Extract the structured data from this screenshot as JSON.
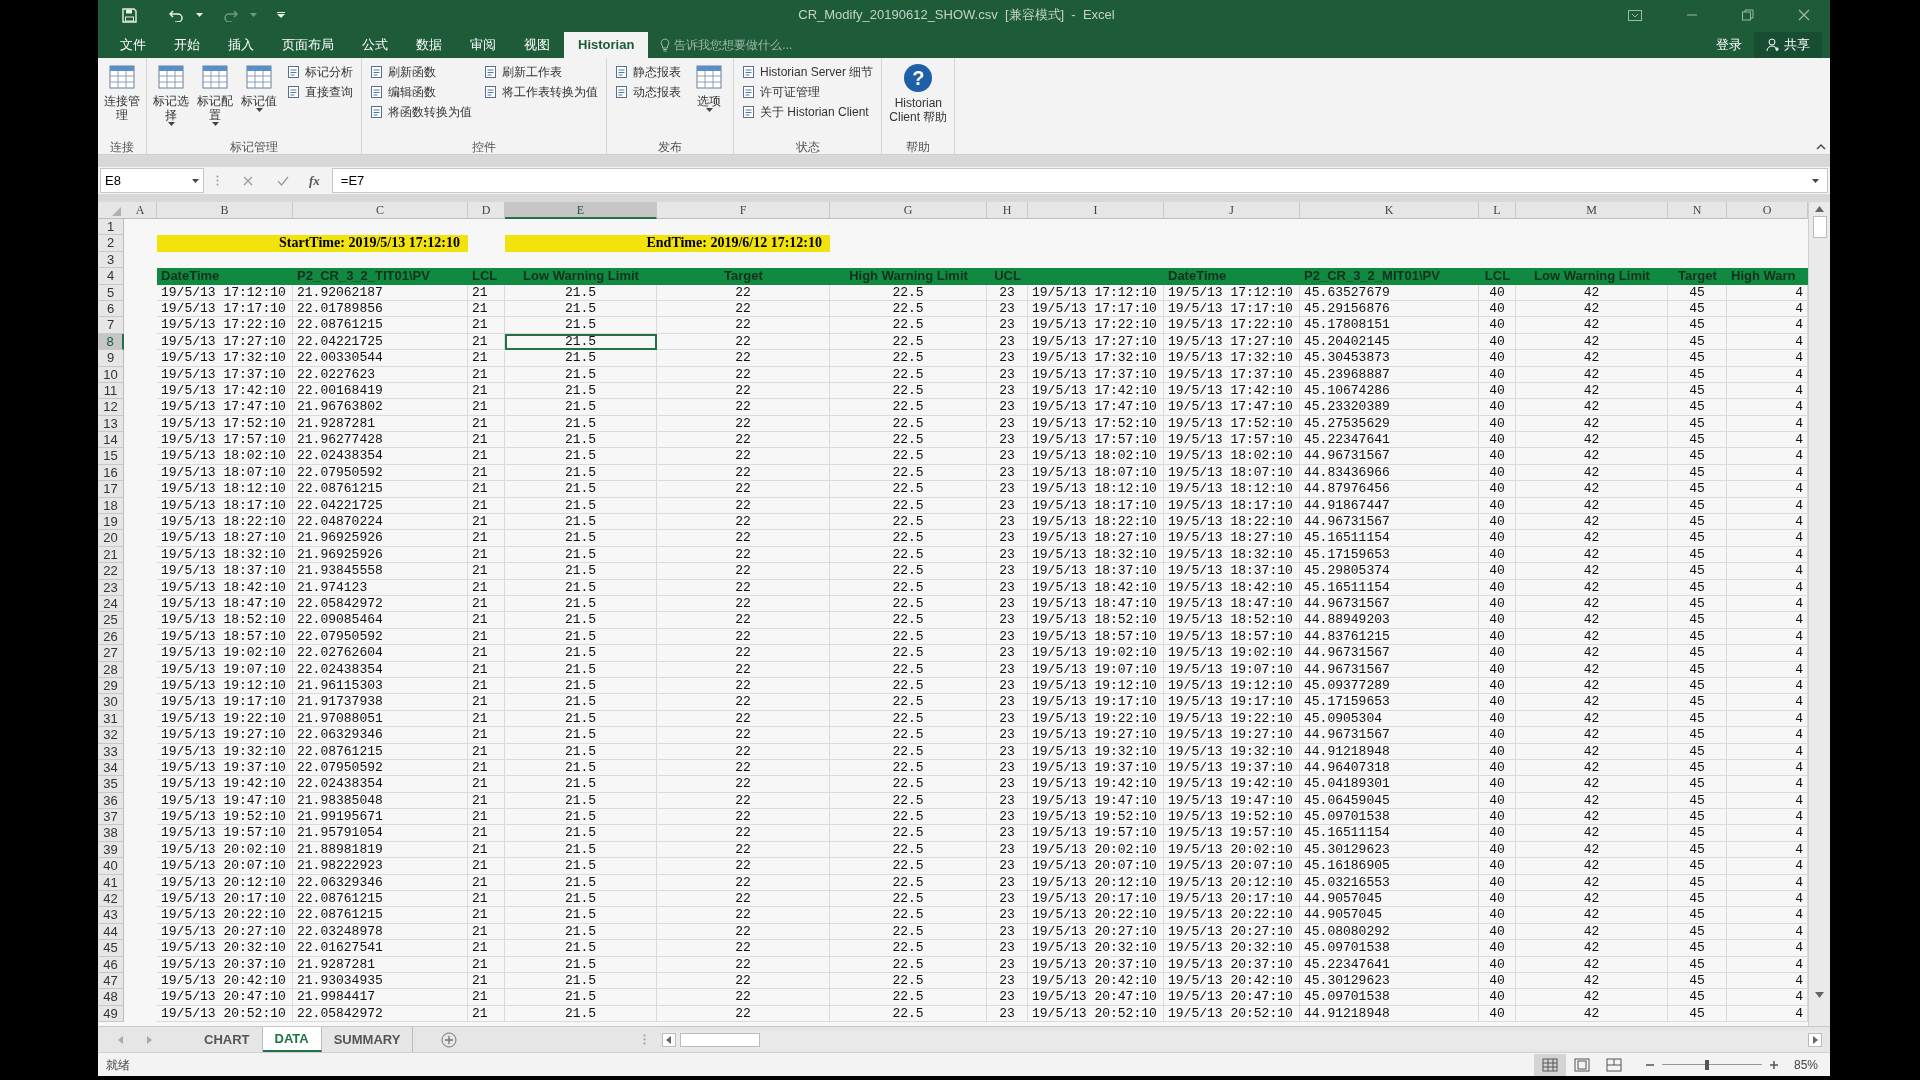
{
  "window": {
    "title": "CR_Modify_20190612_SHOW.csv  [兼容模式]  -  Excel"
  },
  "menu_tabs": [
    {
      "label": "文件",
      "selected": false
    },
    {
      "label": "开始",
      "selected": false
    },
    {
      "label": "插入",
      "selected": false
    },
    {
      "label": "页面布局",
      "selected": false
    },
    {
      "label": "公式",
      "selected": false
    },
    {
      "label": "数据",
      "selected": false
    },
    {
      "label": "审阅",
      "selected": false
    },
    {
      "label": "视图",
      "selected": false
    },
    {
      "label": "Historian",
      "selected": true
    }
  ],
  "tell_me": {
    "placeholder": "告诉我您想要做什么..."
  },
  "account": {
    "sign_in": "登录",
    "share": "共享"
  },
  "ribbon": {
    "groups": [
      {
        "label": "连接",
        "items": [
          {
            "kind": "large",
            "label": "连接管理",
            "dropdown": false
          }
        ]
      },
      {
        "label": "标记管理",
        "items": [
          {
            "kind": "large",
            "label": "标记选择",
            "dropdown": true
          },
          {
            "kind": "large",
            "label": "标记配置",
            "dropdown": true
          },
          {
            "kind": "large",
            "label": "标记值",
            "dropdown": true
          },
          {
            "kind": "stack",
            "labels": [
              "标记分析",
              "直接查询"
            ]
          }
        ]
      },
      {
        "label": "控件",
        "items": [
          {
            "kind": "stack",
            "labels": [
              "刷新函数",
              "编辑函数",
              "将函数转换为值"
            ]
          },
          {
            "kind": "stack",
            "labels": [
              "刷新工作表",
              "将工作表转换为值"
            ]
          }
        ]
      },
      {
        "label": "发布",
        "items": [
          {
            "kind": "stack",
            "labels": [
              "静态报表",
              "动态报表"
            ]
          },
          {
            "kind": "large",
            "label": "选项",
            "dropdown": true
          }
        ]
      },
      {
        "label": "状态",
        "items": [
          {
            "kind": "stack",
            "labels": [
              "Historian Server 细节",
              "许可证管理",
              "关于 Historian Client"
            ]
          }
        ]
      },
      {
        "label": "帮助",
        "items": [
          {
            "kind": "help",
            "symbol": "?",
            "label": "Historian Client 帮助"
          }
        ]
      }
    ]
  },
  "formula_bar": {
    "name_box": "E8",
    "function_label": "fx",
    "formula": "=E7"
  },
  "sheet": {
    "columns": [
      {
        "label": "A",
        "selected": false
      },
      {
        "label": "B",
        "selected": false
      },
      {
        "label": "C",
        "selected": false
      },
      {
        "label": "D",
        "selected": false
      },
      {
        "label": "E",
        "selected": true
      },
      {
        "label": "F",
        "selected": false
      },
      {
        "label": "G",
        "selected": false
      },
      {
        "label": "H",
        "selected": false
      },
      {
        "label": "I",
        "selected": false
      },
      {
        "label": "J",
        "selected": false
      },
      {
        "label": "K",
        "selected": false
      },
      {
        "label": "L",
        "selected": false
      },
      {
        "label": "M",
        "selected": false
      },
      {
        "label": "N",
        "selected": false
      },
      {
        "label": "O",
        "selected": false
      }
    ],
    "rows": [
      {
        "number": "1",
        "selected": false,
        "kind": "blank"
      },
      {
        "number": "2",
        "selected": false,
        "kind": "banner",
        "start": "StartTime: 2019/5/13 17:12:10",
        "end": "EndTime: 2019/6/12 17:12:10"
      },
      {
        "number": "3",
        "selected": false,
        "kind": "blank"
      },
      {
        "number": "4",
        "selected": false,
        "kind": "header",
        "left_headings": [
          "DateTime",
          "P2_CR_3_2_TIT01\\PV",
          "LCL",
          "Low Warning Limit",
          "Target",
          "High Warning Limit",
          "UCL"
        ],
        "right_headings": [
          "DateTime",
          "P2_CR_3_2_MIT01\\PV",
          "LCL",
          "Low Warning Limit",
          "Target",
          "High Warn"
        ]
      },
      {
        "number": "5",
        "selected": false,
        "kind": "data",
        "cells": [
          "19/5/13 17:12:10",
          "21.92062187",
          "21",
          "21.5",
          "22",
          "22.5",
          "23",
          "19/5/13 17:12:10",
          "19/5/13 17:12:10",
          "45.63527679",
          "40",
          "42",
          "45",
          "4"
        ]
      },
      {
        "number": "6",
        "selected": false,
        "kind": "data",
        "cells": [
          "19/5/13 17:17:10",
          "22.01789856",
          "21",
          "21.5",
          "22",
          "22.5",
          "23",
          "19/5/13 17:17:10",
          "19/5/13 17:17:10",
          "45.29156876",
          "40",
          "42",
          "45",
          "4"
        ]
      },
      {
        "number": "7",
        "selected": false,
        "kind": "data",
        "cells": [
          "19/5/13 17:22:10",
          "22.08761215",
          "21",
          "21.5",
          "22",
          "22.5",
          "23",
          "19/5/13 17:22:10",
          "19/5/13 17:22:10",
          "45.17808151",
          "40",
          "42",
          "45",
          "4"
        ]
      },
      {
        "number": "8",
        "selected": true,
        "kind": "data",
        "cells": [
          "19/5/13 17:27:10",
          "22.04221725",
          "21",
          "21.5",
          "22",
          "22.5",
          "23",
          "19/5/13 17:27:10",
          "19/5/13 17:27:10",
          "45.20402145",
          "40",
          "42",
          "45",
          "4"
        ]
      },
      {
        "number": "9",
        "selected": false,
        "kind": "data",
        "cells": [
          "19/5/13 17:32:10",
          "22.00330544",
          "21",
          "21.5",
          "22",
          "22.5",
          "23",
          "19/5/13 17:32:10",
          "19/5/13 17:32:10",
          "45.30453873",
          "40",
          "42",
          "45",
          "4"
        ]
      },
      {
        "number": "10",
        "selected": false,
        "kind": "data",
        "cells": [
          "19/5/13 17:37:10",
          "22.0227623",
          "21",
          "21.5",
          "22",
          "22.5",
          "23",
          "19/5/13 17:37:10",
          "19/5/13 17:37:10",
          "45.23968887",
          "40",
          "42",
          "45",
          "4"
        ]
      },
      {
        "number": "11",
        "selected": false,
        "kind": "data",
        "cells": [
          "19/5/13 17:42:10",
          "22.00168419",
          "21",
          "21.5",
          "22",
          "22.5",
          "23",
          "19/5/13 17:42:10",
          "19/5/13 17:42:10",
          "45.10674286",
          "40",
          "42",
          "45",
          "4"
        ]
      },
      {
        "number": "12",
        "selected": false,
        "kind": "data",
        "cells": [
          "19/5/13 17:47:10",
          "21.96763802",
          "21",
          "21.5",
          "22",
          "22.5",
          "23",
          "19/5/13 17:47:10",
          "19/5/13 17:47:10",
          "45.23320389",
          "40",
          "42",
          "45",
          "4"
        ]
      },
      {
        "number": "13",
        "selected": false,
        "kind": "data",
        "cells": [
          "19/5/13 17:52:10",
          "21.9287281",
          "21",
          "21.5",
          "22",
          "22.5",
          "23",
          "19/5/13 17:52:10",
          "19/5/13 17:52:10",
          "45.27535629",
          "40",
          "42",
          "45",
          "4"
        ]
      },
      {
        "number": "14",
        "selected": false,
        "kind": "data",
        "cells": [
          "19/5/13 17:57:10",
          "21.96277428",
          "21",
          "21.5",
          "22",
          "22.5",
          "23",
          "19/5/13 17:57:10",
          "19/5/13 17:57:10",
          "45.22347641",
          "40",
          "42",
          "45",
          "4"
        ]
      },
      {
        "number": "15",
        "selected": false,
        "kind": "data",
        "cells": [
          "19/5/13 18:02:10",
          "22.02438354",
          "21",
          "21.5",
          "22",
          "22.5",
          "23",
          "19/5/13 18:02:10",
          "19/5/13 18:02:10",
          "44.96731567",
          "40",
          "42",
          "45",
          "4"
        ]
      },
      {
        "number": "16",
        "selected": false,
        "kind": "data",
        "cells": [
          "19/5/13 18:07:10",
          "22.07950592",
          "21",
          "21.5",
          "22",
          "22.5",
          "23",
          "19/5/13 18:07:10",
          "19/5/13 18:07:10",
          "44.83436966",
          "40",
          "42",
          "45",
          "4"
        ]
      },
      {
        "number": "17",
        "selected": false,
        "kind": "data",
        "cells": [
          "19/5/13 18:12:10",
          "22.08761215",
          "21",
          "21.5",
          "22",
          "22.5",
          "23",
          "19/5/13 18:12:10",
          "19/5/13 18:12:10",
          "44.87976456",
          "40",
          "42",
          "45",
          "4"
        ]
      },
      {
        "number": "18",
        "selected": false,
        "kind": "data",
        "cells": [
          "19/5/13 18:17:10",
          "22.04221725",
          "21",
          "21.5",
          "22",
          "22.5",
          "23",
          "19/5/13 18:17:10",
          "19/5/13 18:17:10",
          "44.91867447",
          "40",
          "42",
          "45",
          "4"
        ]
      },
      {
        "number": "19",
        "selected": false,
        "kind": "data",
        "cells": [
          "19/5/13 18:22:10",
          "22.04870224",
          "21",
          "21.5",
          "22",
          "22.5",
          "23",
          "19/5/13 18:22:10",
          "19/5/13 18:22:10",
          "44.96731567",
          "40",
          "42",
          "45",
          "4"
        ]
      },
      {
        "number": "20",
        "selected": false,
        "kind": "data",
        "cells": [
          "19/5/13 18:27:10",
          "21.96925926",
          "21",
          "21.5",
          "22",
          "22.5",
          "23",
          "19/5/13 18:27:10",
          "19/5/13 18:27:10",
          "45.16511154",
          "40",
          "42",
          "45",
          "4"
        ]
      },
      {
        "number": "21",
        "selected": false,
        "kind": "data",
        "cells": [
          "19/5/13 18:32:10",
          "21.96925926",
          "21",
          "21.5",
          "22",
          "22.5",
          "23",
          "19/5/13 18:32:10",
          "19/5/13 18:32:10",
          "45.17159653",
          "40",
          "42",
          "45",
          "4"
        ]
      },
      {
        "number": "22",
        "selected": false,
        "kind": "data",
        "cells": [
          "19/5/13 18:37:10",
          "21.93845558",
          "21",
          "21.5",
          "22",
          "22.5",
          "23",
          "19/5/13 18:37:10",
          "19/5/13 18:37:10",
          "45.29805374",
          "40",
          "42",
          "45",
          "4"
        ]
      },
      {
        "number": "23",
        "selected": false,
        "kind": "data",
        "cells": [
          "19/5/13 18:42:10",
          "21.974123",
          "21",
          "21.5",
          "22",
          "22.5",
          "23",
          "19/5/13 18:42:10",
          "19/5/13 18:42:10",
          "45.16511154",
          "40",
          "42",
          "45",
          "4"
        ]
      },
      {
        "number": "24",
        "selected": false,
        "kind": "data",
        "cells": [
          "19/5/13 18:47:10",
          "22.05842972",
          "21",
          "21.5",
          "22",
          "22.5",
          "23",
          "19/5/13 18:47:10",
          "19/5/13 18:47:10",
          "44.96731567",
          "40",
          "42",
          "45",
          "4"
        ]
      },
      {
        "number": "25",
        "selected": false,
        "kind": "data",
        "cells": [
          "19/5/13 18:52:10",
          "22.09085464",
          "21",
          "21.5",
          "22",
          "22.5",
          "23",
          "19/5/13 18:52:10",
          "19/5/13 18:52:10",
          "44.88949203",
          "40",
          "42",
          "45",
          "4"
        ]
      },
      {
        "number": "26",
        "selected": false,
        "kind": "data",
        "cells": [
          "19/5/13 18:57:10",
          "22.07950592",
          "21",
          "21.5",
          "22",
          "22.5",
          "23",
          "19/5/13 18:57:10",
          "19/5/13 18:57:10",
          "44.83761215",
          "40",
          "42",
          "45",
          "4"
        ]
      },
      {
        "number": "27",
        "selected": false,
        "kind": "data",
        "cells": [
          "19/5/13 19:02:10",
          "22.02762604",
          "21",
          "21.5",
          "22",
          "22.5",
          "23",
          "19/5/13 19:02:10",
          "19/5/13 19:02:10",
          "44.96731567",
          "40",
          "42",
          "45",
          "4"
        ]
      },
      {
        "number": "28",
        "selected": false,
        "kind": "data",
        "cells": [
          "19/5/13 19:07:10",
          "22.02438354",
          "21",
          "21.5",
          "22",
          "22.5",
          "23",
          "19/5/13 19:07:10",
          "19/5/13 19:07:10",
          "44.96731567",
          "40",
          "42",
          "45",
          "4"
        ]
      },
      {
        "number": "29",
        "selected": false,
        "kind": "data",
        "cells": [
          "19/5/13 19:12:10",
          "21.96115303",
          "21",
          "21.5",
          "22",
          "22.5",
          "23",
          "19/5/13 19:12:10",
          "19/5/13 19:12:10",
          "45.09377289",
          "40",
          "42",
          "45",
          "4"
        ]
      },
      {
        "number": "30",
        "selected": false,
        "kind": "data",
        "cells": [
          "19/5/13 19:17:10",
          "21.91737938",
          "21",
          "21.5",
          "22",
          "22.5",
          "23",
          "19/5/13 19:17:10",
          "19/5/13 19:17:10",
          "45.17159653",
          "40",
          "42",
          "45",
          "4"
        ]
      },
      {
        "number": "31",
        "selected": false,
        "kind": "data",
        "cells": [
          "19/5/13 19:22:10",
          "21.97088051",
          "21",
          "21.5",
          "22",
          "22.5",
          "23",
          "19/5/13 19:22:10",
          "19/5/13 19:22:10",
          "45.0905304",
          "40",
          "42",
          "45",
          "4"
        ]
      },
      {
        "number": "32",
        "selected": false,
        "kind": "data",
        "cells": [
          "19/5/13 19:27:10",
          "22.06329346",
          "21",
          "21.5",
          "22",
          "22.5",
          "23",
          "19/5/13 19:27:10",
          "19/5/13 19:27:10",
          "44.96731567",
          "40",
          "42",
          "45",
          "4"
        ]
      },
      {
        "number": "33",
        "selected": false,
        "kind": "data",
        "cells": [
          "19/5/13 19:32:10",
          "22.08761215",
          "21",
          "21.5",
          "22",
          "22.5",
          "23",
          "19/5/13 19:32:10",
          "19/5/13 19:32:10",
          "44.91218948",
          "40",
          "42",
          "45",
          "4"
        ]
      },
      {
        "number": "34",
        "selected": false,
        "kind": "data",
        "cells": [
          "19/5/13 19:37:10",
          "22.07950592",
          "21",
          "21.5",
          "22",
          "22.5",
          "23",
          "19/5/13 19:37:10",
          "19/5/13 19:37:10",
          "44.96407318",
          "40",
          "42",
          "45",
          "4"
        ]
      },
      {
        "number": "35",
        "selected": false,
        "kind": "data",
        "cells": [
          "19/5/13 19:42:10",
          "22.02438354",
          "21",
          "21.5",
          "22",
          "22.5",
          "23",
          "19/5/13 19:42:10",
          "19/5/13 19:42:10",
          "45.04189301",
          "40",
          "42",
          "45",
          "4"
        ]
      },
      {
        "number": "36",
        "selected": false,
        "kind": "data",
        "cells": [
          "19/5/13 19:47:10",
          "21.98385048",
          "21",
          "21.5",
          "22",
          "22.5",
          "23",
          "19/5/13 19:47:10",
          "19/5/13 19:47:10",
          "45.06459045",
          "40",
          "42",
          "45",
          "4"
        ]
      },
      {
        "number": "37",
        "selected": false,
        "kind": "data",
        "cells": [
          "19/5/13 19:52:10",
          "21.99195671",
          "21",
          "21.5",
          "22",
          "22.5",
          "23",
          "19/5/13 19:52:10",
          "19/5/13 19:52:10",
          "45.09701538",
          "40",
          "42",
          "45",
          "4"
        ]
      },
      {
        "number": "38",
        "selected": false,
        "kind": "data",
        "cells": [
          "19/5/13 19:57:10",
          "21.95791054",
          "21",
          "21.5",
          "22",
          "22.5",
          "23",
          "19/5/13 19:57:10",
          "19/5/13 19:57:10",
          "45.16511154",
          "40",
          "42",
          "45",
          "4"
        ]
      },
      {
        "number": "39",
        "selected": false,
        "kind": "data",
        "cells": [
          "19/5/13 20:02:10",
          "21.88981819",
          "21",
          "21.5",
          "22",
          "22.5",
          "23",
          "19/5/13 20:02:10",
          "19/5/13 20:02:10",
          "45.30129623",
          "40",
          "42",
          "45",
          "4"
        ]
      },
      {
        "number": "40",
        "selected": false,
        "kind": "data",
        "cells": [
          "19/5/13 20:07:10",
          "21.98222923",
          "21",
          "21.5",
          "22",
          "22.5",
          "23",
          "19/5/13 20:07:10",
          "19/5/13 20:07:10",
          "45.16186905",
          "40",
          "42",
          "45",
          "4"
        ]
      },
      {
        "number": "41",
        "selected": false,
        "kind": "data",
        "cells": [
          "19/5/13 20:12:10",
          "22.06329346",
          "21",
          "21.5",
          "22",
          "22.5",
          "23",
          "19/5/13 20:12:10",
          "19/5/13 20:12:10",
          "45.03216553",
          "40",
          "42",
          "45",
          "4"
        ]
      },
      {
        "number": "42",
        "selected": false,
        "kind": "data",
        "cells": [
          "19/5/13 20:17:10",
          "22.08761215",
          "21",
          "21.5",
          "22",
          "22.5",
          "23",
          "19/5/13 20:17:10",
          "19/5/13 20:17:10",
          "44.9057045",
          "40",
          "42",
          "45",
          "4"
        ]
      },
      {
        "number": "43",
        "selected": false,
        "kind": "data",
        "cells": [
          "19/5/13 20:22:10",
          "22.08761215",
          "21",
          "21.5",
          "22",
          "22.5",
          "23",
          "19/5/13 20:22:10",
          "19/5/13 20:22:10",
          "44.9057045",
          "40",
          "42",
          "45",
          "4"
        ]
      },
      {
        "number": "44",
        "selected": false,
        "kind": "data",
        "cells": [
          "19/5/13 20:27:10",
          "22.03248978",
          "21",
          "21.5",
          "22",
          "22.5",
          "23",
          "19/5/13 20:27:10",
          "19/5/13 20:27:10",
          "45.08080292",
          "40",
          "42",
          "45",
          "4"
        ]
      },
      {
        "number": "45",
        "selected": false,
        "kind": "data",
        "cells": [
          "19/5/13 20:32:10",
          "22.01627541",
          "21",
          "21.5",
          "22",
          "22.5",
          "23",
          "19/5/13 20:32:10",
          "19/5/13 20:32:10",
          "45.09701538",
          "40",
          "42",
          "45",
          "4"
        ]
      },
      {
        "number": "46",
        "selected": false,
        "kind": "data",
        "cells": [
          "19/5/13 20:37:10",
          "21.9287281",
          "21",
          "21.5",
          "22",
          "22.5",
          "23",
          "19/5/13 20:37:10",
          "19/5/13 20:37:10",
          "45.22347641",
          "40",
          "42",
          "45",
          "4"
        ]
      },
      {
        "number": "47",
        "selected": false,
        "kind": "data",
        "cells": [
          "19/5/13 20:42:10",
          "21.93034935",
          "21",
          "21.5",
          "22",
          "22.5",
          "23",
          "19/5/13 20:42:10",
          "19/5/13 20:42:10",
          "45.30129623",
          "40",
          "42",
          "45",
          "4"
        ]
      },
      {
        "number": "48",
        "selected": false,
        "kind": "data",
        "cells": [
          "19/5/13 20:47:10",
          "21.9984417",
          "21",
          "21.5",
          "22",
          "22.5",
          "23",
          "19/5/13 20:47:10",
          "19/5/13 20:47:10",
          "45.09701538",
          "40",
          "42",
          "45",
          "4"
        ]
      },
      {
        "number": "49",
        "selected": false,
        "kind": "data",
        "cells": [
          "19/5/13 20:52:10",
          "22.05842972",
          "21",
          "21.5",
          "22",
          "22.5",
          "23",
          "19/5/13 20:52:10",
          "19/5/13 20:52:10",
          "44.91218948",
          "40",
          "42",
          "45",
          "4"
        ]
      }
    ]
  },
  "sheet_tabs": [
    {
      "label": "CHART",
      "selected": false
    },
    {
      "label": "DATA",
      "selected": true
    },
    {
      "label": "SUMMARY",
      "selected": false
    }
  ],
  "status_bar": {
    "text": "就绪",
    "views": [
      {
        "kind": "normal",
        "selected": true
      },
      {
        "kind": "page_layout",
        "selected": false
      },
      {
        "kind": "page_break",
        "selected": false
      }
    ],
    "zoom": {
      "level": 0.45,
      "label": "85%"
    }
  }
}
